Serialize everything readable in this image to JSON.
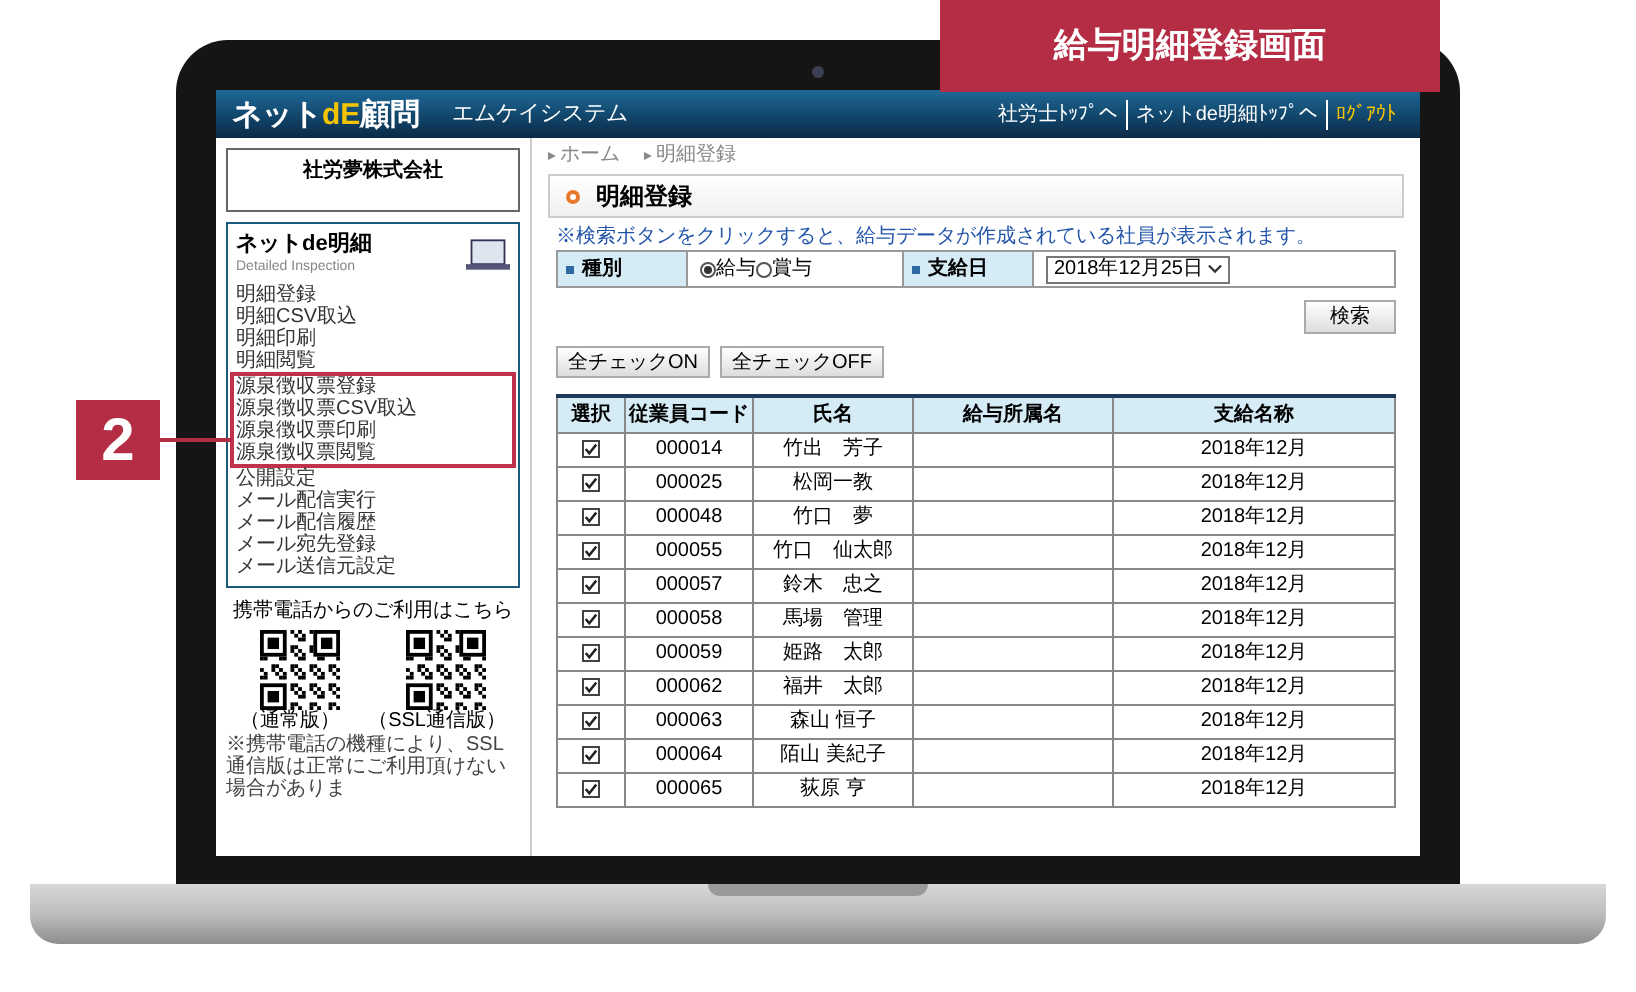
{
  "banner": {
    "title": "給与明細登録画面"
  },
  "callout": {
    "label": "2"
  },
  "header": {
    "logo": {
      "prefix": "ネット",
      "accent": "dE",
      "suffix": "顧問"
    },
    "company": "エムケイシステム",
    "links": [
      "社労士ﾄｯﾌﾟへ",
      "ネットde明細ﾄｯﾌﾟへ",
      "ﾛｸﾞｱｳﾄ"
    ]
  },
  "sidebar": {
    "company_name": "社労夢株式会社",
    "nav_title": "ネットde明細",
    "nav_subtitle": "Detailed Inspection",
    "menu_groups": [
      {
        "highlighted": false,
        "items": [
          "明細登録",
          "明細CSV取込",
          "明細印刷",
          "明細閲覧"
        ]
      },
      {
        "highlighted": true,
        "items": [
          "源泉徴収票登録",
          "源泉徴収票CSV取込",
          "源泉徴収票印刷",
          "源泉徴収票閲覧"
        ]
      },
      {
        "highlighted": false,
        "items": [
          "公開設定",
          "メール配信実行",
          "メール配信履歴",
          "メール宛先登録",
          "メール送信元設定"
        ]
      }
    ],
    "mobile_title": "携帯電話からのご利用はこちら",
    "qr_labels": [
      "（通常版）",
      "（SSL通信版）"
    ],
    "mobile_note": "※携帯電話の機種により、SSL通信版は正常にご利用頂けない場合がありま"
  },
  "main": {
    "breadcrumb": [
      "ホーム",
      "明細登録"
    ],
    "title": "明細登録",
    "note": "※検索ボタンをクリックすると、給与データが作成されている社員が表示されます。",
    "form": {
      "type_label": "種別",
      "type_options": [
        {
          "label": "給与",
          "selected": true
        },
        {
          "label": "賞与",
          "selected": false
        }
      ],
      "date_label": "支給日",
      "date_value": "2018年12月25日"
    },
    "search_button": "検索",
    "check_buttons": [
      "全チェックON",
      "全チェックOFF"
    ],
    "table": {
      "columns": [
        "選択",
        "従業員コード",
        "氏名",
        "給与所属名",
        "支給名称"
      ],
      "rows": [
        {
          "checked": true,
          "code": "000014",
          "name": "竹出　芳子",
          "department": "",
          "payment": "2018年12月"
        },
        {
          "checked": true,
          "code": "000025",
          "name": "松岡一教",
          "department": "",
          "payment": "2018年12月"
        },
        {
          "checked": true,
          "code": "000048",
          "name": "竹口　夢",
          "department": "",
          "payment": "2018年12月"
        },
        {
          "checked": true,
          "code": "000055",
          "name": "竹口　仙太郎",
          "department": "",
          "payment": "2018年12月"
        },
        {
          "checked": true,
          "code": "000057",
          "name": "鈴木　忠之",
          "department": "",
          "payment": "2018年12月"
        },
        {
          "checked": true,
          "code": "000058",
          "name": "馬場　管理",
          "department": "",
          "payment": "2018年12月"
        },
        {
          "checked": true,
          "code": "000059",
          "name": "姫路　太郎",
          "department": "",
          "payment": "2018年12月"
        },
        {
          "checked": true,
          "code": "000062",
          "name": "福井　太郎",
          "department": "",
          "payment": "2018年12月"
        },
        {
          "checked": true,
          "code": "000063",
          "name": "森山 恒子",
          "department": "",
          "payment": "2018年12月"
        },
        {
          "checked": true,
          "code": "000064",
          "name": "陌山 美紀子",
          "department": "",
          "payment": "2018年12月"
        },
        {
          "checked": true,
          "code": "000065",
          "name": "荻原 亨",
          "department": "",
          "payment": "2018年12月"
        }
      ]
    }
  }
}
